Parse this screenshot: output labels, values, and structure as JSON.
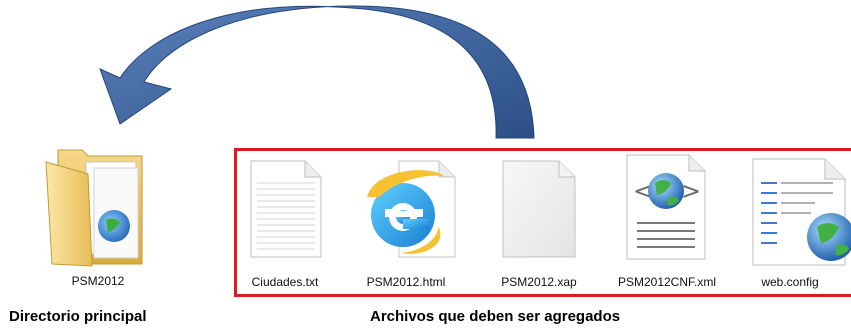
{
  "folder": {
    "name": "PSM2012",
    "caption": "Directorio principal",
    "icon": "folder-icon"
  },
  "files_group": {
    "caption": "Archivos que deben ser agregados",
    "border_color": "#e01820",
    "files": [
      {
        "name": "Ciudades.txt",
        "icon": "text-file-icon"
      },
      {
        "name": "PSM2012.html",
        "icon": "internet-explorer-icon"
      },
      {
        "name": "PSM2012.xap",
        "icon": "blank-file-icon"
      },
      {
        "name": "PSM2012CNF.xml",
        "icon": "xml-file-icon"
      },
      {
        "name": "web.config",
        "icon": "config-file-icon"
      }
    ]
  },
  "arrow": {
    "color": "#3a5f98",
    "direction": "files-to-folder"
  }
}
